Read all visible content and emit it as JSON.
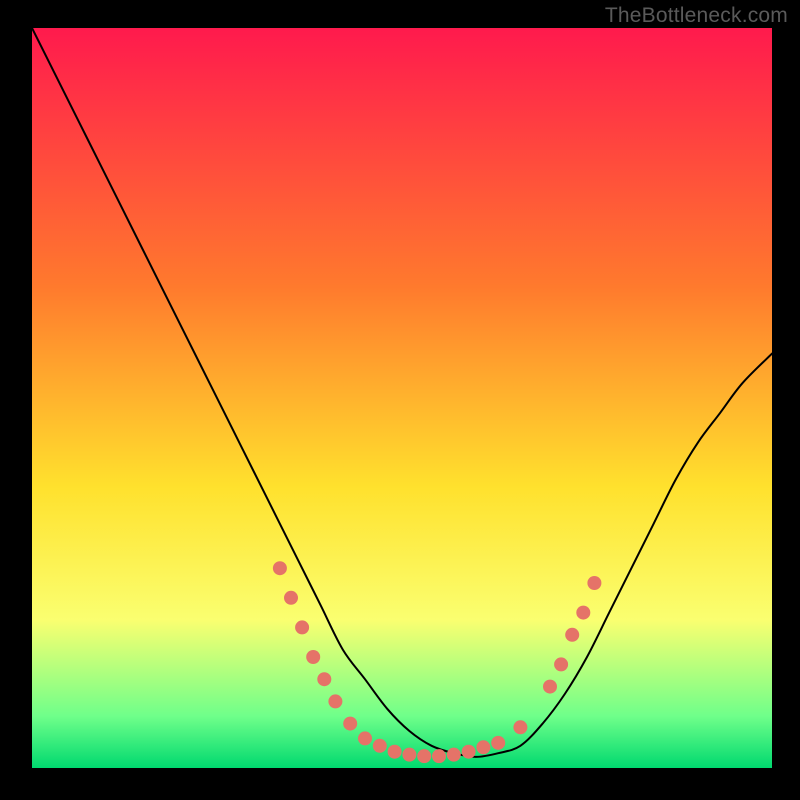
{
  "watermark": "TheBottleneck.com",
  "colors": {
    "background": "#000000",
    "watermark_text": "#5a5a5a",
    "gradient_top": "#ff1a4d",
    "gradient_mid1": "#ff7a2d",
    "gradient_mid2": "#ffe12d",
    "gradient_low": "#faff70",
    "gradient_green_light": "#6fff8a",
    "gradient_green_deep": "#00d96f",
    "curve": "#000000",
    "marker": "#e57368"
  },
  "chart_data": {
    "type": "line",
    "title": "",
    "xlabel": "",
    "ylabel": "",
    "ylim": [
      0,
      100
    ],
    "xlim": [
      0,
      100
    ],
    "series": [
      {
        "name": "bottleneck-curve",
        "x": [
          0,
          3,
          6,
          9,
          12,
          15,
          18,
          21,
          24,
          27,
          30,
          33,
          36,
          39,
          42,
          45,
          48,
          51,
          54,
          57,
          60,
          63,
          66,
          69,
          72,
          75,
          78,
          81,
          84,
          87,
          90,
          93,
          96,
          100
        ],
        "values": [
          100,
          94,
          88,
          82,
          76,
          70,
          64,
          58,
          52,
          46,
          40,
          34,
          28,
          22,
          16,
          12,
          8,
          5,
          3,
          2,
          1.5,
          2,
          3,
          6,
          10,
          15,
          21,
          27,
          33,
          39,
          44,
          48,
          52,
          56
        ]
      }
    ],
    "markers": {
      "name": "highlight-dots",
      "points": [
        {
          "x": 33.5,
          "y": 27
        },
        {
          "x": 35.0,
          "y": 23
        },
        {
          "x": 36.5,
          "y": 19
        },
        {
          "x": 38.0,
          "y": 15
        },
        {
          "x": 39.5,
          "y": 12
        },
        {
          "x": 41.0,
          "y": 9
        },
        {
          "x": 43.0,
          "y": 6
        },
        {
          "x": 45.0,
          "y": 4
        },
        {
          "x": 47.0,
          "y": 3
        },
        {
          "x": 49.0,
          "y": 2.2
        },
        {
          "x": 51.0,
          "y": 1.8
        },
        {
          "x": 53.0,
          "y": 1.6
        },
        {
          "x": 55.0,
          "y": 1.6
        },
        {
          "x": 57.0,
          "y": 1.8
        },
        {
          "x": 59.0,
          "y": 2.2
        },
        {
          "x": 61.0,
          "y": 2.8
        },
        {
          "x": 63.0,
          "y": 3.4
        },
        {
          "x": 66.0,
          "y": 5.5
        },
        {
          "x": 70.0,
          "y": 11
        },
        {
          "x": 71.5,
          "y": 14
        },
        {
          "x": 73.0,
          "y": 18
        },
        {
          "x": 74.5,
          "y": 21
        },
        {
          "x": 76.0,
          "y": 25
        }
      ]
    }
  }
}
